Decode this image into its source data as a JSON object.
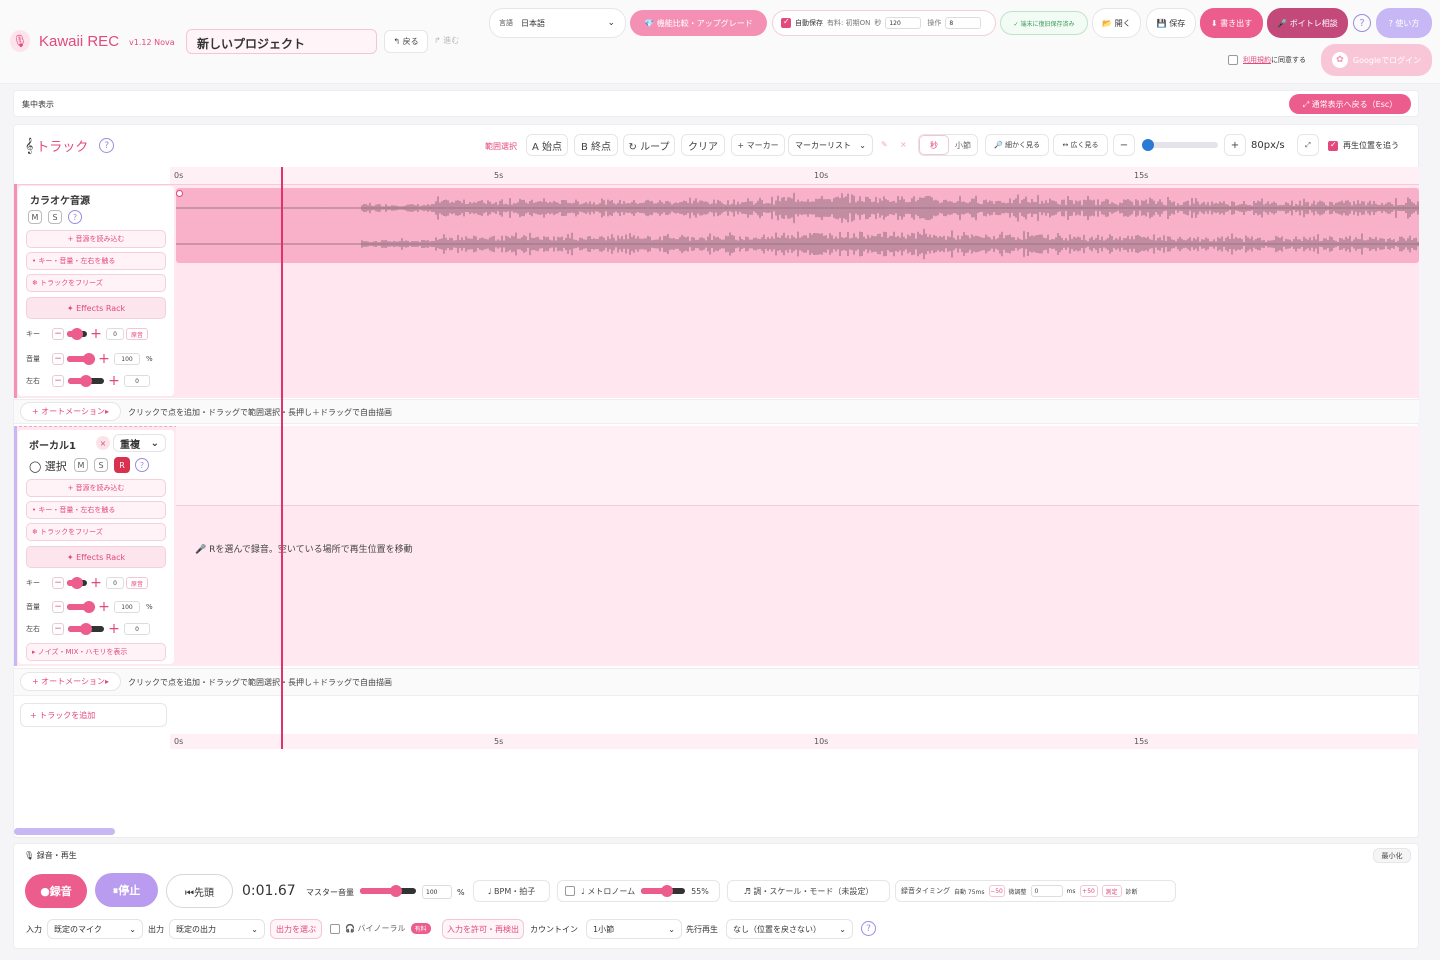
{
  "app": {
    "name": "Kawaii REC",
    "version": "v1.12 Nova",
    "project": "新しいプロジェクト",
    "back": "↰ 戻る",
    "forward": "↱ 進む"
  },
  "header": {
    "lang_label": "言語",
    "lang_value": "日本語",
    "upgrade": "💎 機能比較・アップグレード",
    "autosave": "自動保存",
    "autosave_info": "有料: 初期ON",
    "sec_label": "秒",
    "sec_value": "120",
    "ops_label": "操作",
    "ops_value": "8",
    "saved_badge": "✓ 端末に復旧保存済み",
    "open": "📂 開く",
    "save": "💾 保存",
    "export": "⬇ 書き出す",
    "voice": "🎤 ボイトレ相談",
    "help": "?",
    "howto": "? 使い方",
    "terms_link": "利用規約",
    "terms_rest": "に同意する",
    "google": "Googleでログイン"
  },
  "focus": {
    "label": "集中表示",
    "back": "⤢ 通常表示へ戻る（Esc）"
  },
  "toolbar": {
    "title": "トラック",
    "range": "範囲選択",
    "a": "A 始点",
    "b": "B 終点",
    "loop": "↻ ループ",
    "clear": "クリア",
    "marker": "+ マーカー",
    "marker_list": "マーカーリスト",
    "sec": "秒",
    "bar": "小節",
    "zoom_in": "🔎 細かく見る",
    "zoom_out": "↔ 広く見る",
    "minus": "−",
    "plus": "+",
    "zoom": "80px/s",
    "follow": "再生位置を追う",
    "expand": "⤢"
  },
  "ruler": {
    "t0": "0s",
    "t5": "5s",
    "t10": "10s",
    "t15": "15s"
  },
  "track1": {
    "name": "カラオケ音源",
    "m": "M",
    "s": "S",
    "q": "?",
    "load": "+ 音源を読み込む",
    "adjust": "• キー・音量・左右を触る",
    "freeze": "❄ トラックをフリーズ",
    "effects": "✦ Effects Rack",
    "key_label": "キー",
    "key_value": "0",
    "key_tag": "原音",
    "vol_label": "音量",
    "vol_value": "100",
    "pct": "%",
    "pan_label": "左右",
    "pan_value": "0",
    "automation": "+ オートメーション▸",
    "hint": "クリックで点を追加・ドラッグで範囲選択・長押し＋ドラッグで自由描画"
  },
  "track2": {
    "name": "ボーカル1",
    "x": "×",
    "mode": "重複",
    "select": "◯ 選択",
    "m": "M",
    "s": "S",
    "r": "R",
    "q": "?",
    "load": "+ 音源を読み込む",
    "adjust": "• キー・音量・左右を触る",
    "freeze": "❄ トラックをフリーズ",
    "effects": "✦ Effects Rack",
    "key_label": "キー",
    "key_value": "0",
    "key_tag": "原音",
    "vol_label": "音量",
    "vol_value": "100",
    "pct": "%",
    "pan_label": "左右",
    "pan_value": "0",
    "noise": "▸ ノイズ・MIX・ハモリを表示",
    "automation": "+ オートメーション▸",
    "hint": "クリックで点を追加・ドラッグで範囲選択・長押し＋ドラッグで自由描画",
    "empty_msg": "🎤 Rを選んで録音。空いている場所で再生位置を移動"
  },
  "add_track": "+ トラックを追加",
  "transport": {
    "title": "🎙 録音・再生",
    "minimize": "最小化",
    "rec": "●録音",
    "stop": "⏸停止",
    "rewind": "⏮先頭",
    "time": "0:01.67",
    "master_label": "マスター音量",
    "master_value": "100",
    "pct": "%",
    "bpm": "♩ BPM・拍子",
    "metronome": "♩ メトロノーム",
    "metro_pct": "55%",
    "scale": "♬ 調・スケール・モード（未設定）",
    "timing": "録音タイミング",
    "timing_auto": "自動 75ms",
    "m50": "−50",
    "fine": "微調整",
    "fine_value": "0",
    "ms": "ms",
    "p50": "+50",
    "measure": "測定",
    "diag": "診断",
    "input_label": "入力",
    "input_value": "既定のマイク",
    "output_label": "出力",
    "output_value": "既定の出力",
    "choose_out": "出力を選ぶ",
    "binaural": "🎧 バイノーラル",
    "paid": "有料",
    "allow": "入力を許可・再検出",
    "countin_label": "カウントイン",
    "countin_value": "1小節",
    "preroll_label": "先行再生",
    "preroll_value": "なし（位置を戻さない）",
    "help": "?"
  }
}
